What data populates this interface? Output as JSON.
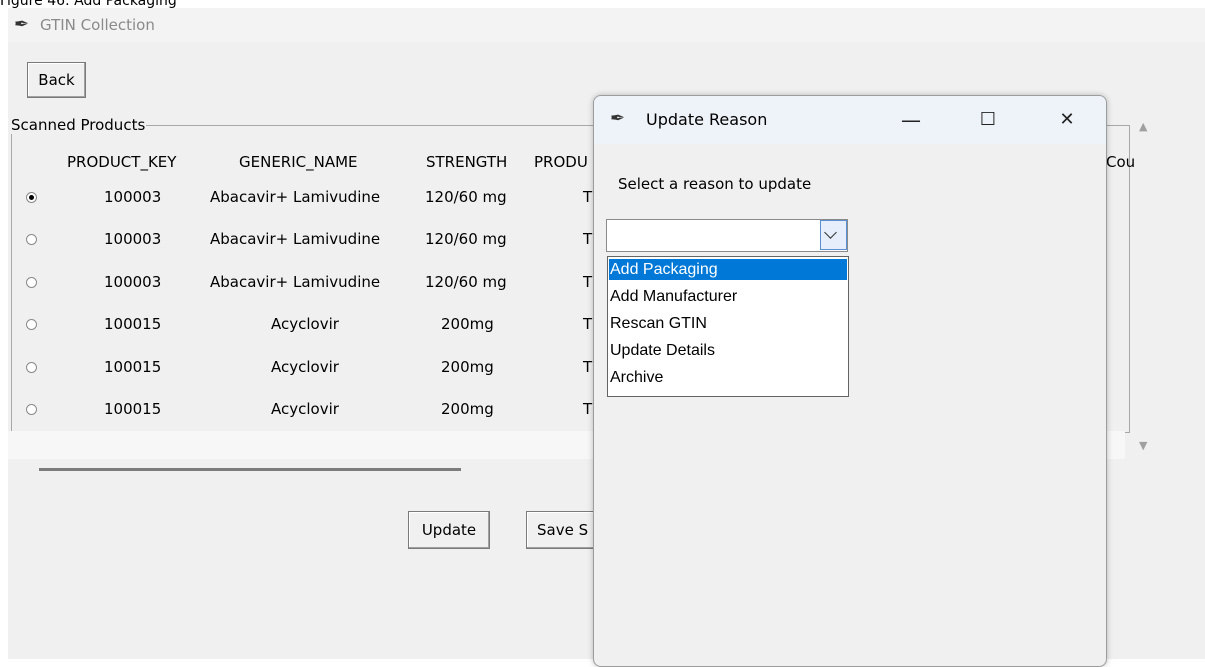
{
  "caption": "Figure 46: Add Packaging",
  "main_window": {
    "title": "GTIN Collection",
    "back_label": "Back",
    "frame_label": "Scanned Products",
    "columns": [
      "PRODUCT_KEY",
      "GENERIC_NAME",
      "STRENGTH",
      "PRODU",
      "Cou"
    ],
    "rows": [
      {
        "selected": true,
        "product_key": "100003",
        "generic_name": "Abacavir+ Lamivudine",
        "strength": "120/60 mg",
        "product": "T"
      },
      {
        "selected": false,
        "product_key": "100003",
        "generic_name": "Abacavir+ Lamivudine",
        "strength": "120/60 mg",
        "product": "T"
      },
      {
        "selected": false,
        "product_key": "100003",
        "generic_name": "Abacavir+ Lamivudine",
        "strength": "120/60 mg",
        "product": "T"
      },
      {
        "selected": false,
        "product_key": "100015",
        "generic_name": "Acyclovir",
        "strength": "200mg",
        "product": "T"
      },
      {
        "selected": false,
        "product_key": "100015",
        "generic_name": "Acyclovir",
        "strength": "200mg",
        "product": "T"
      },
      {
        "selected": false,
        "product_key": "100015",
        "generic_name": "Acyclovir",
        "strength": "200mg",
        "product": "T"
      }
    ],
    "update_label": "Update",
    "save_label": "Save S"
  },
  "dialog": {
    "title": "Update Reason",
    "minimize_glyph": "—",
    "maximize_glyph": "☐",
    "close_glyph": "✕",
    "prompt": "Select a reason to update",
    "combo_value": "",
    "options": [
      "Add Packaging",
      "Add Manufacturer",
      "Rescan GTIN",
      "Update Details",
      "Archive"
    ],
    "highlighted_index": 0,
    "highlight_color": "#0078d7"
  }
}
